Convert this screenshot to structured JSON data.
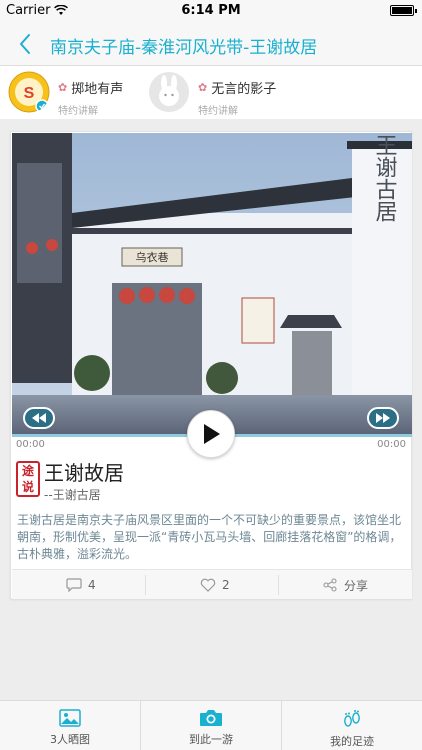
{
  "status": {
    "carrier": "Carrier",
    "time": "6:14 PM"
  },
  "nav": {
    "title": "南京夫子庙-秦淮河风光带-王谢故居"
  },
  "guides": [
    {
      "name": "掷地有声",
      "tag": "特约讲解"
    },
    {
      "name": "无言的影子",
      "tag": "特约讲解"
    }
  ],
  "player": {
    "time_start": "00:00",
    "time_end": "00:00",
    "progress": 0
  },
  "photo": {
    "door_sign": "乌衣巷",
    "wall_text": "王谢古居"
  },
  "stamp": {
    "text": "途说"
  },
  "place": {
    "title": "王谢故居",
    "subtitle": "--王谢古居",
    "description": "王谢古居是南京夫子庙风景区里面的一个不可缺少的重要景点，该馆坐北朝南，形制优美，呈现一派“青砖小瓦马头墙、回廊挂落花格窗”的格调，古朴典雅，溢彩流光。"
  },
  "actions": {
    "comments": "4",
    "likes": "2",
    "share": "分享"
  },
  "tabs": [
    {
      "label": "3人晒图"
    },
    {
      "label": "到此一游"
    },
    {
      "label": "我的足迹"
    }
  ],
  "colors": {
    "accent": "#1ab0cf",
    "stamp": "#c8232c",
    "progress": "#8fcbe0"
  }
}
